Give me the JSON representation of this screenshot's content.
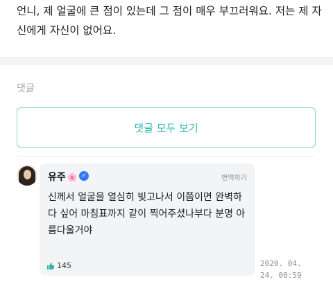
{
  "post": {
    "text": "언니, 제 얼굴에 큰 점이 있는데 그 점이 매우 부끄러워요. 저는 제 자신에게 자신이 없어요."
  },
  "comments_section": {
    "label": "댓글",
    "view_all_button": "댓글 모두 보기"
  },
  "comment": {
    "username": "유주",
    "username_emoji": "🌸",
    "verified_icon": "verified-check-icon",
    "translate_label": "번역하기",
    "text": "신께서 얼굴을 열심히 빚고나서 이쯤이면 완벽하다 싶어 마침표까지 같이 찍어주셨나부다 분명 아름다울거야",
    "like_icon": "thumbs-up-icon",
    "like_count": "145",
    "timestamp": "2020. 04. 24. 00:59"
  },
  "colors": {
    "accent": "#36b8b3",
    "accent_border": "#7fd3d0",
    "verified": "#3478f6",
    "bubble": "#f3f4f6",
    "divider": "#f3f4f6"
  }
}
